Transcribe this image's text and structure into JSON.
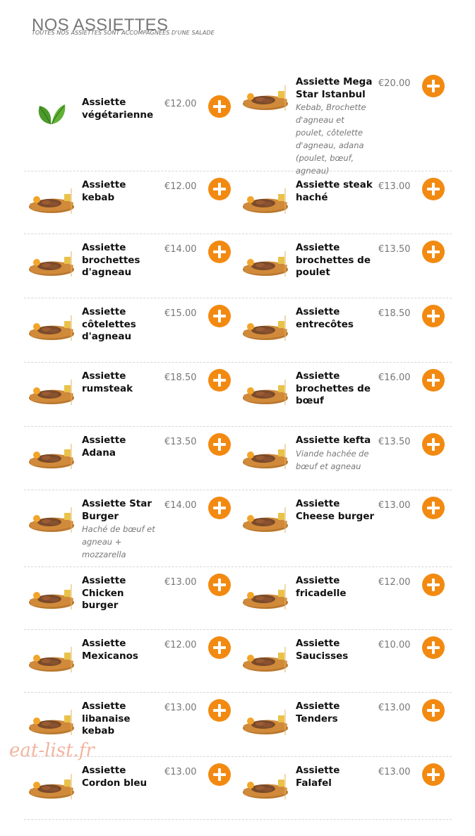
{
  "header": {
    "title": "NOS ASSIETTES",
    "subtitle": "TOUTES NOS ASSIETTES SONT ACCOMPAGNÉES D'UNE SALADE"
  },
  "colors": {
    "accent": "#f28a12",
    "price": "#777777",
    "title": "#777777"
  },
  "rows": [
    {
      "left": {
        "name": "Assiette végétarienne",
        "desc": "",
        "price": "€12.00",
        "image": "vegetarian-leaf-icon"
      },
      "right": {
        "name": "Assiette Mega Star Istanbul",
        "desc": "Kebab, Brochette d'agneau et poulet, côtelette d'agneau, adana (poulet, bœuf, agneau)",
        "price": "€20.00",
        "image": "plate-photo"
      }
    },
    {
      "left": {
        "name": "Assiette kebab",
        "desc": "",
        "price": "€12.00",
        "image": "plate-photo"
      },
      "right": {
        "name": "Assiette steak haché",
        "desc": "",
        "price": "€13.00",
        "image": "plate-photo"
      }
    },
    {
      "left": {
        "name": "Assiette brochettes d'agneau",
        "desc": "",
        "price": "€14.00",
        "image": "plate-photo"
      },
      "right": {
        "name": "Assiette brochettes de poulet",
        "desc": "",
        "price": "€13.50",
        "image": "plate-photo"
      }
    },
    {
      "left": {
        "name": "Assiette côtelettes d'agneau",
        "desc": "",
        "price": "€15.00",
        "image": "plate-photo"
      },
      "right": {
        "name": "Assiette entrecôtes",
        "desc": "",
        "price": "€18.50",
        "image": "plate-photo"
      }
    },
    {
      "left": {
        "name": "Assiette rumsteak",
        "desc": "",
        "price": "€18.50",
        "image": "plate-photo"
      },
      "right": {
        "name": "Assiette brochettes de bœuf",
        "desc": "",
        "price": "€16.00",
        "image": "plate-photo"
      }
    },
    {
      "left": {
        "name": "Assiette Adana",
        "desc": "",
        "price": "€13.50",
        "image": "plate-photo"
      },
      "right": {
        "name": "Assiette kefta",
        "desc": "Viande hachée de bœuf et agneau",
        "price": "€13.50",
        "image": "plate-photo"
      }
    },
    {
      "left": {
        "name": "Assiette Star Burger",
        "desc": "Haché de bœuf et agneau + mozzarella",
        "price": "€14.00",
        "image": "plate-photo"
      },
      "right": {
        "name": "Assiette Cheese burger",
        "desc": "",
        "price": "€13.00",
        "image": "plate-photo"
      }
    },
    {
      "left": {
        "name": "Assiette Chicken burger",
        "desc": "",
        "price": "€13.00",
        "image": "plate-photo"
      },
      "right": {
        "name": "Assiette fricadelle",
        "desc": "",
        "price": "€12.00",
        "image": "plate-photo"
      }
    },
    {
      "left": {
        "name": "Assiette Mexicanos",
        "desc": "",
        "price": "€12.00",
        "image": "plate-photo"
      },
      "right": {
        "name": "Assiette Saucisses",
        "desc": "",
        "price": "€10.00",
        "image": "plate-photo"
      }
    },
    {
      "left": {
        "name": "Assiette libanaise kebab",
        "desc": "",
        "price": "€13.00",
        "image": "plate-photo"
      },
      "right": {
        "name": "Assiette Tenders",
        "desc": "",
        "price": "€13.00",
        "image": "plate-photo"
      }
    },
    {
      "left": {
        "name": "Assiette Cordon bleu",
        "desc": "",
        "price": "€13.00",
        "image": "plate-photo"
      },
      "right": {
        "name": "Assiette Falafel",
        "desc": "",
        "price": "€13.00",
        "image": "plate-photo"
      }
    }
  ],
  "watermark": "eat-list.fr"
}
